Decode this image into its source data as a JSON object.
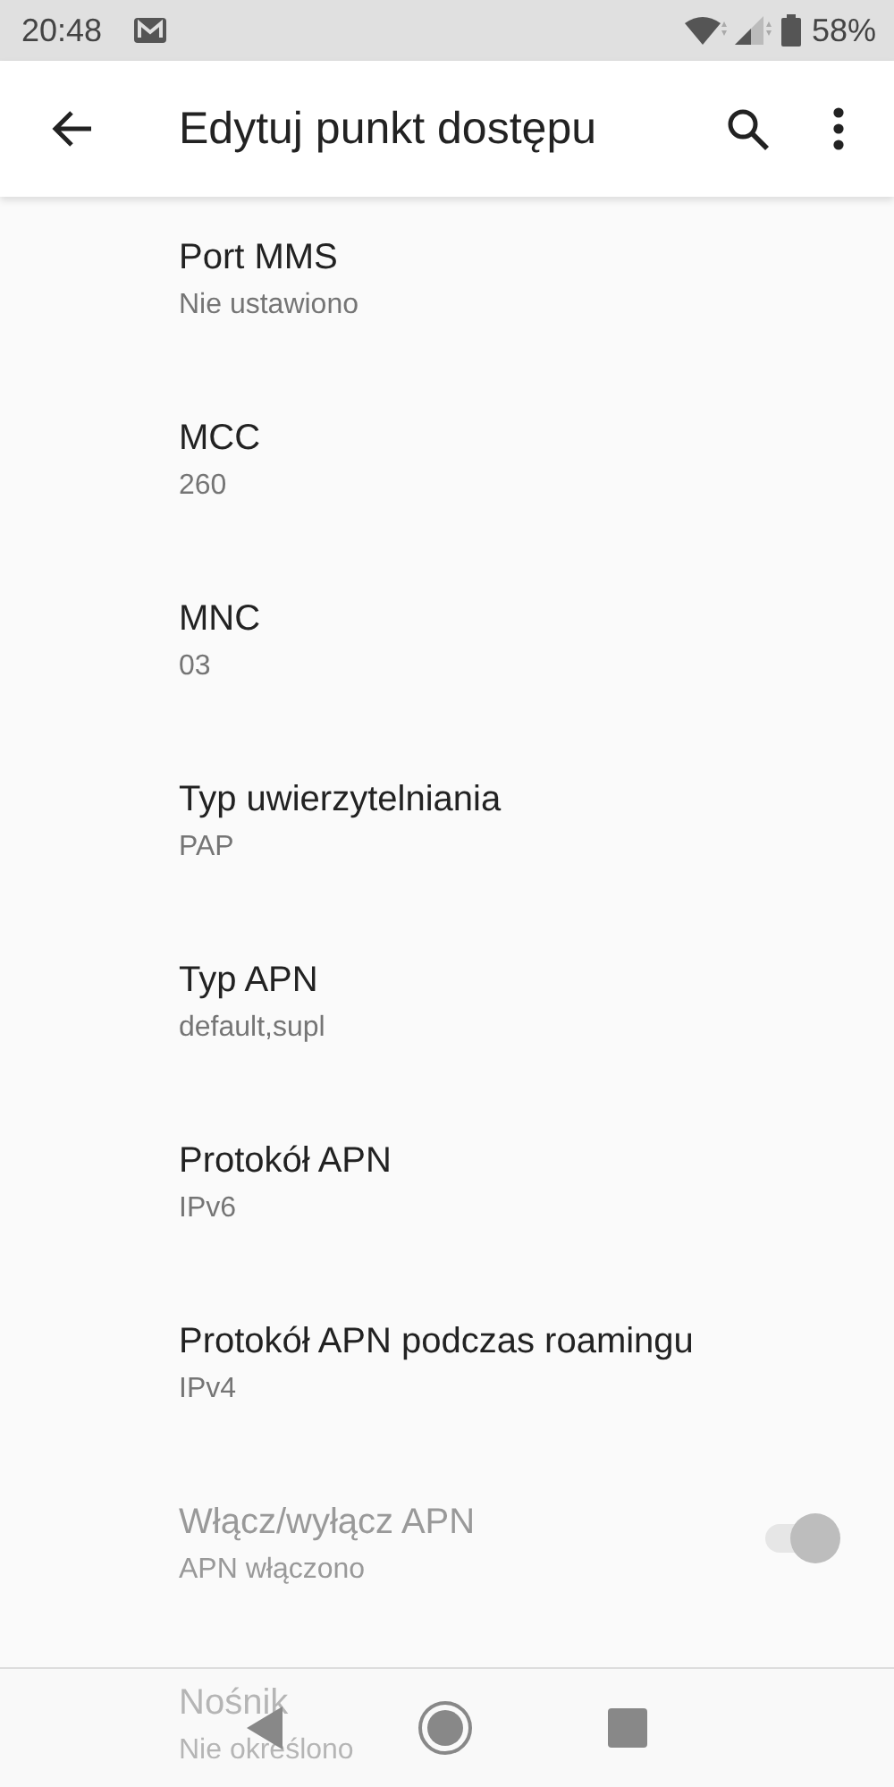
{
  "status_bar": {
    "time": "20:48",
    "battery": "58%"
  },
  "app_bar": {
    "title": "Edytuj punkt dostępu"
  },
  "settings": [
    {
      "kind": "text",
      "title": "Port MMS",
      "summary": "Nie ustawiono",
      "disabled": false
    },
    {
      "kind": "text",
      "title": "MCC",
      "summary": "260",
      "disabled": false
    },
    {
      "kind": "text",
      "title": "MNC",
      "summary": "03",
      "disabled": false
    },
    {
      "kind": "text",
      "title": "Typ uwierzytelniania",
      "summary": "PAP",
      "disabled": false
    },
    {
      "kind": "text",
      "title": "Typ APN",
      "summary": "default,supl",
      "disabled": false
    },
    {
      "kind": "text",
      "title": "Protokół APN",
      "summary": "IPv6",
      "disabled": false
    },
    {
      "kind": "text",
      "title": "Protokół APN podczas roamingu",
      "summary": "IPv4",
      "disabled": false
    },
    {
      "kind": "switch",
      "title": "Włącz/wyłącz APN",
      "summary": "APN włączono",
      "disabled": true,
      "on": true
    },
    {
      "kind": "text",
      "title": "Nośnik",
      "summary": "Nie określono",
      "disabled": true
    }
  ]
}
